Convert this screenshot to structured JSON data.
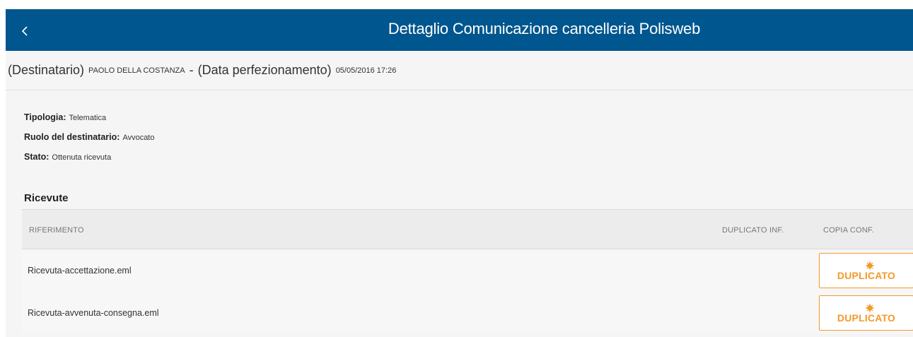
{
  "header": {
    "title": "Dettaglio Comunicazione cancelleria Polisweb",
    "back_icon": "chevron-left-icon"
  },
  "subheader": {
    "recipient_label": "(Destinatario)",
    "recipient_value": "PAOLO DELLA COSTANZA",
    "separator": "-",
    "date_label": "(Data perfezionamento)",
    "date_value": "05/05/2016 17:26"
  },
  "info": [
    {
      "key": "Tipologia:",
      "value": "Telematica"
    },
    {
      "key": "Ruolo del destinatario:",
      "value": "Avvocato"
    },
    {
      "key": "Stato:",
      "value": "Ottenuta ricevuta"
    }
  ],
  "receipts": {
    "title": "Ricevute",
    "columns": [
      "RIFERIMENTO",
      "DUPLICATO INF.",
      "COPIA CONF."
    ],
    "rows": [
      {
        "reference": "Ricevuta-accettazione.eml",
        "button_label": "DUPLICATO",
        "button_icon": "burst-icon"
      },
      {
        "reference": "Ricevuta-avvenuta-consegna.eml",
        "button_label": "DUPLICATO",
        "button_icon": "burst-icon"
      }
    ]
  },
  "colors": {
    "header_bg": "#00568e",
    "accent_orange": "#f39a2a",
    "panel_bg": "#f5f5f5"
  }
}
